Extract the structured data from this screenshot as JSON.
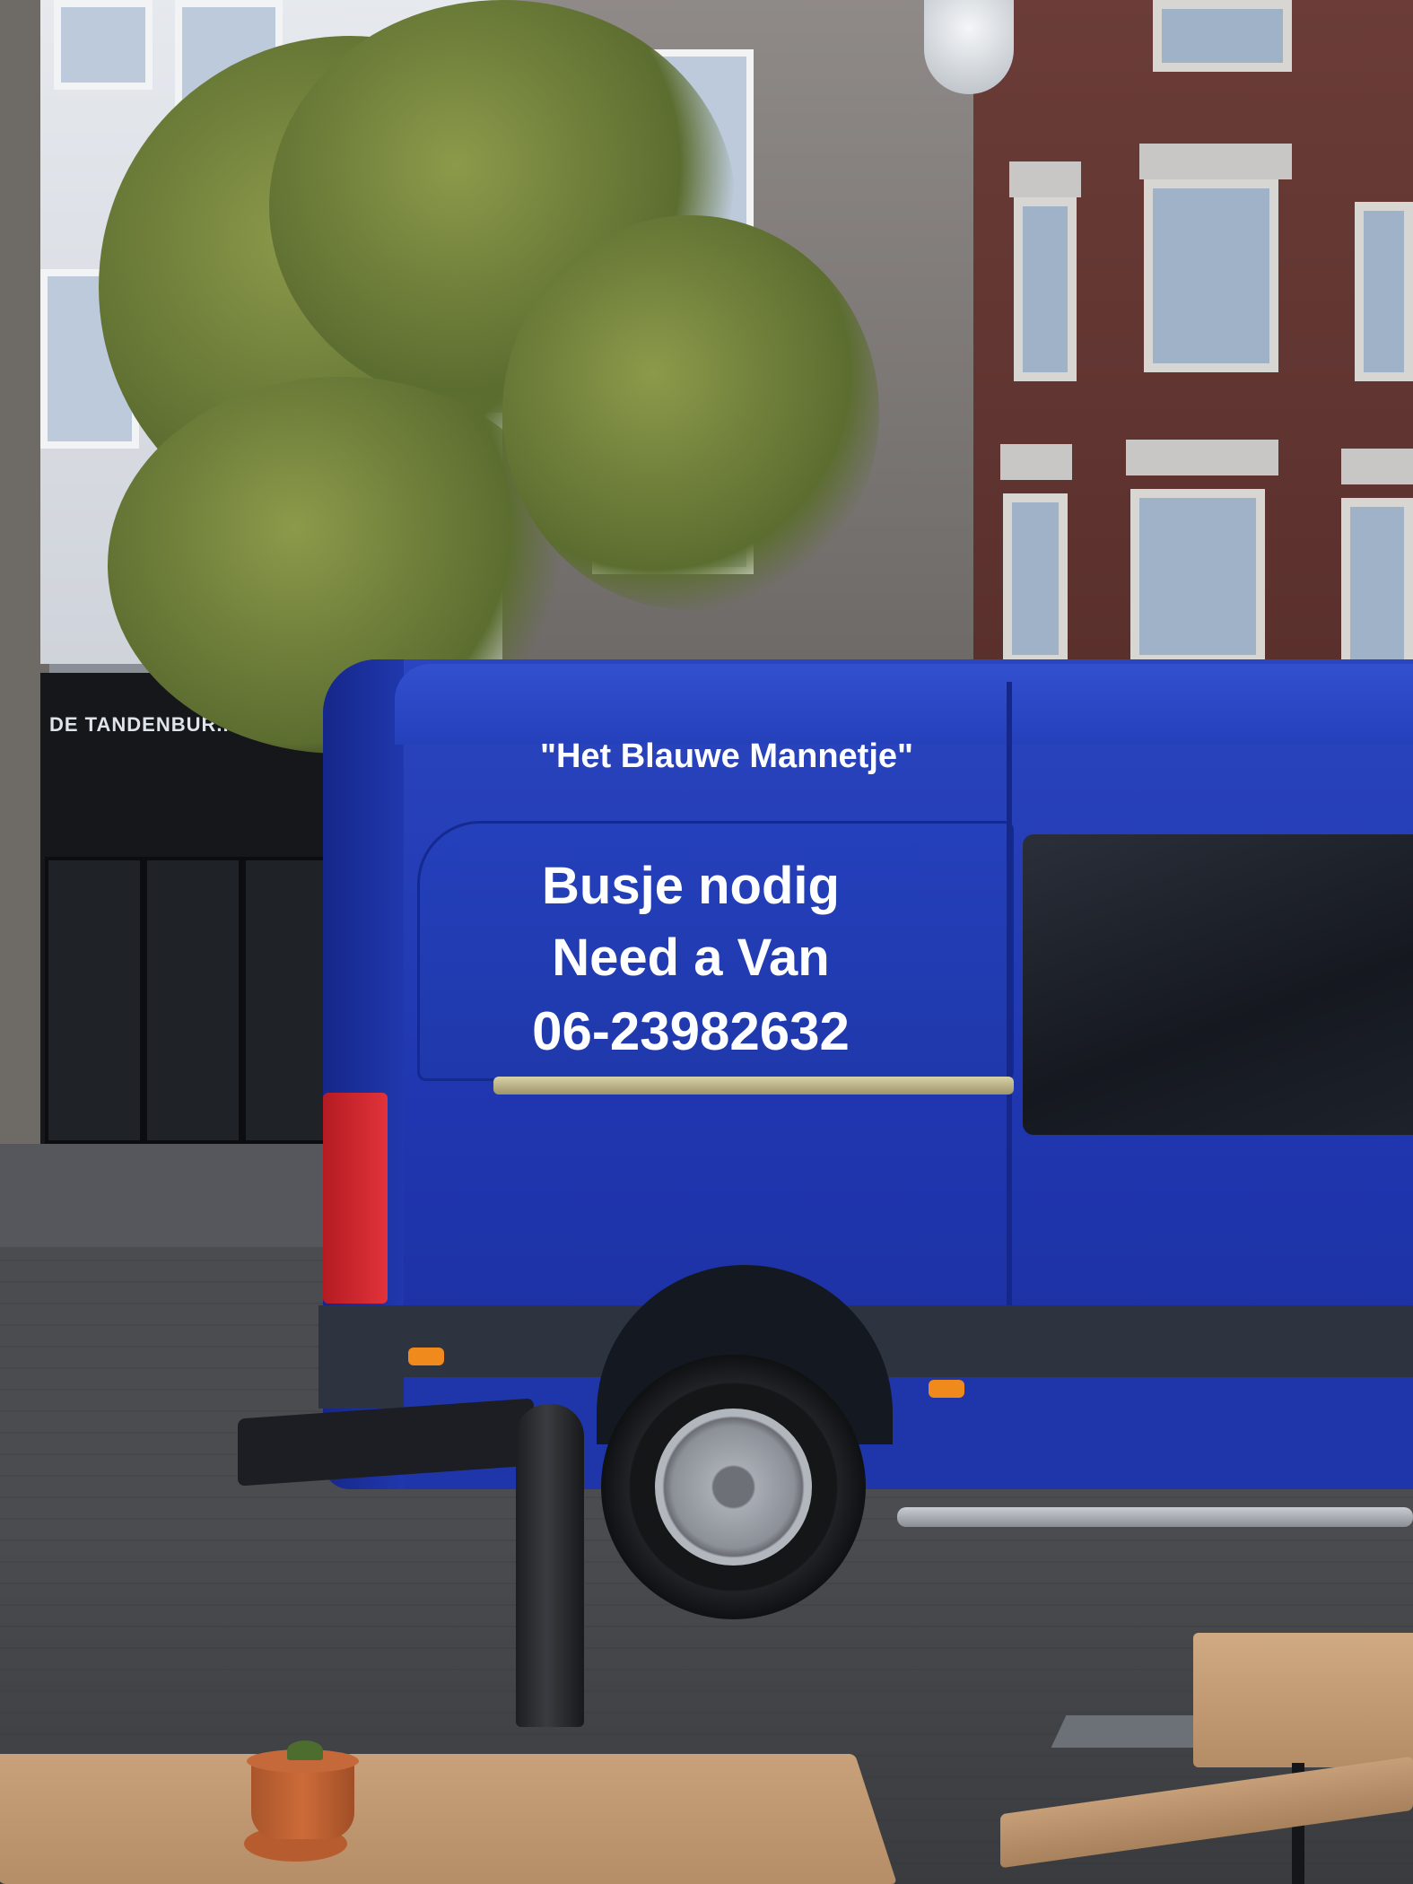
{
  "scene": {
    "van_color": "#2540bb",
    "shop_sign": "DE TANDENBUR...",
    "van_slogan": "\"Het Blauwe Mannetje\"",
    "van_ad_lines": [
      "Busje nodig",
      "Need a Van",
      "06-23982632"
    ]
  }
}
